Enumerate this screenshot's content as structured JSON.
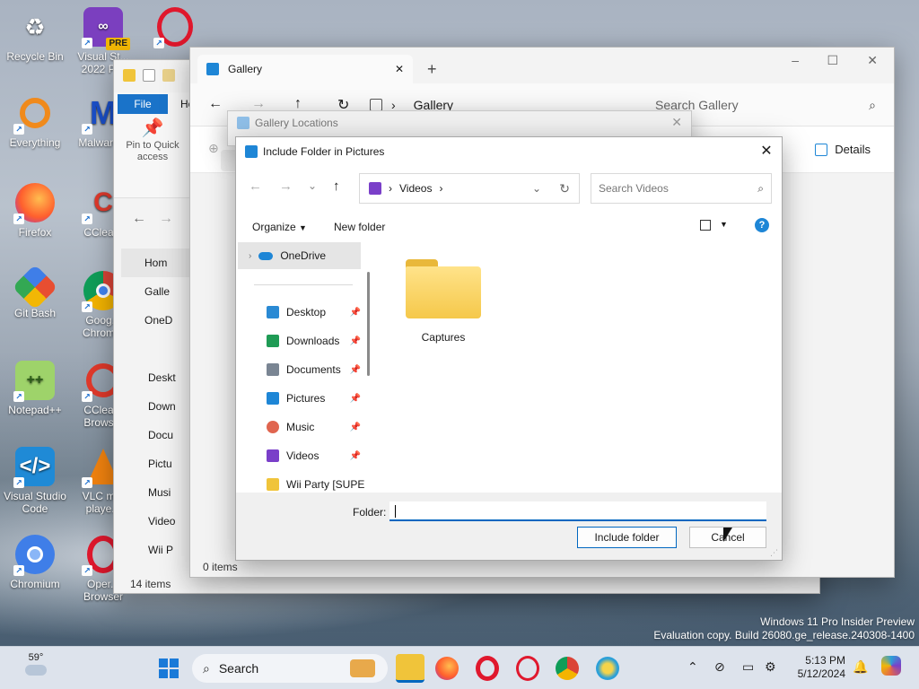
{
  "desktop": {
    "icons": [
      {
        "label": "Recycle Bin"
      },
      {
        "label": "Visual Studio 2022 Preview",
        "short": "Visual St... 2022 Pre",
        "badge": "PRE"
      },
      {
        "label": "Opera",
        "short": "Opera..."
      },
      {
        "label": "Everything"
      },
      {
        "label": "Malwarebytes",
        "short": "Malware..."
      },
      {
        "label": "Firefox"
      },
      {
        "label": "CCleaner",
        "short": "CClea..."
      },
      {
        "label": "Git Bash"
      },
      {
        "label": "Google Chrome",
        "short": "Goog... Chrom..."
      },
      {
        "label": "Notepad++"
      },
      {
        "label": "CCleaner Browser",
        "short": "CClea... Brows..."
      },
      {
        "label": "Visual Studio Code"
      },
      {
        "label": "VLC media player",
        "short": "VLC m... playe..."
      },
      {
        "label": "Chromium"
      },
      {
        "label": "Opera Browser",
        "short": "Oper... Browser"
      }
    ],
    "watermark_line1": "Windows 11 Pro Insider Preview",
    "watermark_line2": "Evaluation copy. Build 26080.ge_release.240308-1400"
  },
  "explorer_back": {
    "file_tab": "File",
    "home_tab": "Ho",
    "pin_label": "Pin to Quick access",
    "nav_items": [
      "Hom",
      "Galle",
      "OneD",
      "Deskt",
      "Down",
      "Docu",
      "Pictu",
      "Musi",
      "Video",
      "Wii P"
    ],
    "status": "14 items"
  },
  "gallery": {
    "tab_title": "Gallery",
    "new_tab": "+",
    "address": "Gallery",
    "search_placeholder": "Search Gallery",
    "details_label": "Details",
    "status": "0 items",
    "min": "–",
    "max": "☐",
    "close": "✕"
  },
  "gallery_locations": {
    "title": "Gallery Locations",
    "close": "✕"
  },
  "include_dialog": {
    "title": "Include Folder in Pictures",
    "close": "✕",
    "address_crumb": "Videos",
    "search_placeholder": "Search Videos",
    "organize": "Organize",
    "new_folder": "New folder",
    "help": "?",
    "nav": {
      "onedrive": "OneDrive",
      "items": [
        {
          "label": "Desktop",
          "icon": "desktop-icon",
          "color": "#2a8ad4"
        },
        {
          "label": "Downloads",
          "icon": "download-icon",
          "color": "#1f9b55"
        },
        {
          "label": "Documents",
          "icon": "document-icon",
          "color": "#7a8593"
        },
        {
          "label": "Pictures",
          "icon": "pictures-icon",
          "color": "#1e86d6"
        },
        {
          "label": "Music",
          "icon": "music-icon",
          "color": "#e0654f"
        },
        {
          "label": "Videos",
          "icon": "videos-icon",
          "color": "#7a3fc9"
        },
        {
          "label": "Wii Party [SUPE",
          "icon": "folder-icon",
          "color": "#f0c43a"
        }
      ]
    },
    "folder_item": "Captures",
    "folder_label": "Folder:",
    "folder_value": "",
    "include_button": "Include folder",
    "cancel_button": "Cancel"
  },
  "taskbar": {
    "weather_temp": "59°",
    "search_label": "Search",
    "time": "5:13 PM",
    "date": "5/12/2024"
  },
  "colors": {
    "accent": "#0067c0",
    "folder": "#f5c84a"
  }
}
